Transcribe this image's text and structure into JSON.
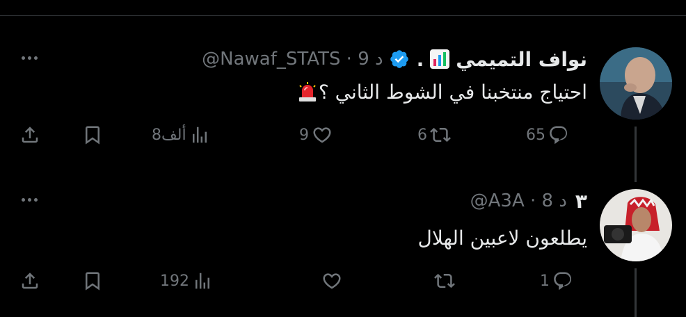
{
  "tweets": [
    {
      "display_name": "نواف التميمي",
      "name_suffix_dot": ".",
      "handle_meta": "@Nawaf_STATS · 9 د",
      "verified": true,
      "text": "احتياج منتخبنا في الشوط الثاني ؟",
      "text_prefix_icon": "siren-icon",
      "replies": "65",
      "retweets": "6",
      "likes": "9",
      "views": "8ألف"
    },
    {
      "display_name": "٣",
      "handle_meta": "@A3A · 8 د",
      "verified": false,
      "text": "يطلعون لاعبين الهلال",
      "replies": "1",
      "retweets": "",
      "likes": "",
      "views": "192"
    }
  ],
  "colors": {
    "background": "#000000",
    "text_primary": "#e7e9ea",
    "text_secondary": "#71767b",
    "verified_blue": "#1d9bf0",
    "thread_line": "#333639"
  }
}
